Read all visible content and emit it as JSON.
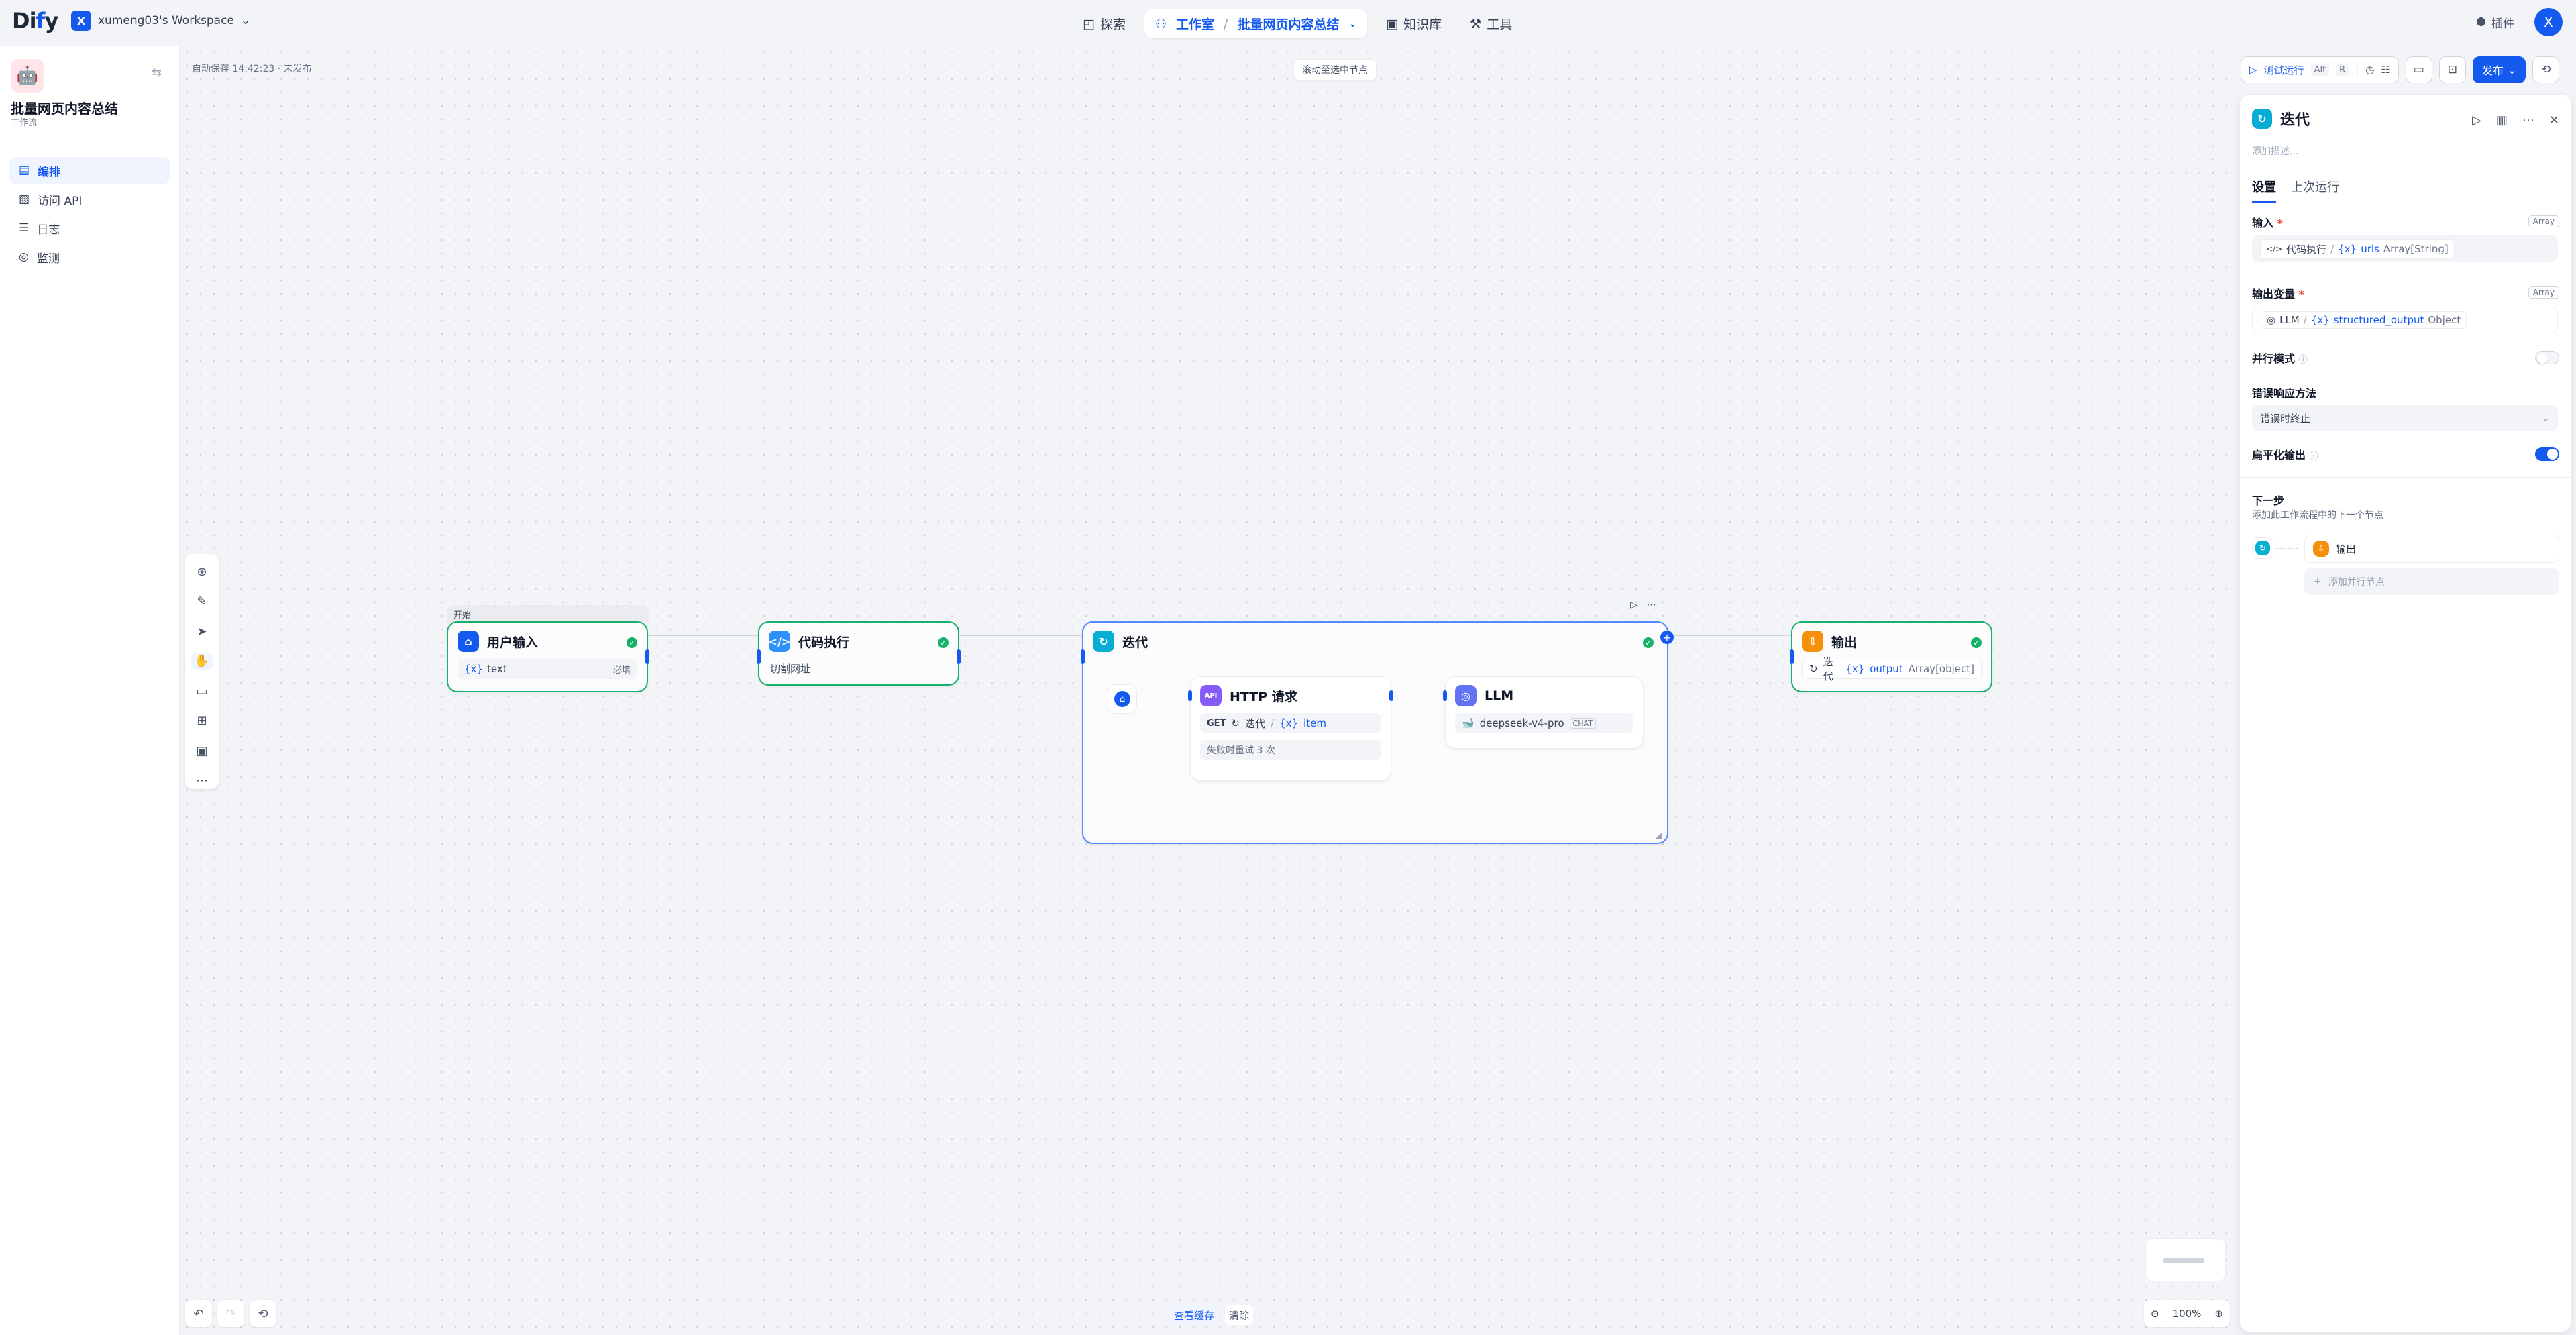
{
  "topbar": {
    "logo_pre": "Di",
    "logo_mid": "f",
    "logo_post": "y",
    "workspace_initial": "X",
    "workspace_name": "xumeng03's Workspace",
    "nav": {
      "explore": "探索",
      "studio": "工作室",
      "current_app": "批量网页内容总结",
      "knowledge": "知识库",
      "tools": "工具"
    },
    "plugins": "插件",
    "avatar_initial": "X"
  },
  "sidebar": {
    "app_title": "批量网页内容总结",
    "app_type": "工作流",
    "menu": [
      {
        "label": "编排",
        "icon": "orchestrate-icon"
      },
      {
        "label": "访问 API",
        "icon": "api-icon"
      },
      {
        "label": "日志",
        "icon": "logs-icon"
      },
      {
        "label": "监测",
        "icon": "monitor-icon"
      }
    ]
  },
  "canvas": {
    "autosave": "自动保存 14:42:23 · 未发布",
    "scroll_to_selected": "滚动至选中节点",
    "start_label": "开始",
    "nodes": {
      "user_input": {
        "title": "用户输入",
        "var": "text",
        "required": "必填"
      },
      "code": {
        "title": "代码执行",
        "desc": "切割网址"
      },
      "iteration": {
        "title": "迭代"
      },
      "http": {
        "title": "HTTP 请求",
        "method": "GET",
        "source": "迭代",
        "var": "item",
        "retry": "失败时重试 3 次"
      },
      "llm": {
        "title": "LLM",
        "model": "deepseek-v4-pro",
        "mode": "CHAT"
      },
      "output": {
        "title": "输出",
        "source": "迭代",
        "var": "output",
        "type": "Array[object]"
      }
    },
    "view_cache": "查看缓存",
    "clear": "清除",
    "zoom": "100%"
  },
  "toolbar_right": {
    "test_run": "测试运行",
    "shortcut_alt": "Alt",
    "shortcut_r": "R",
    "publish": "发布"
  },
  "panel": {
    "title": "迭代",
    "description_placeholder": "添加描述...",
    "tabs": [
      "设置",
      "上次运行"
    ],
    "input": {
      "label": "输入",
      "type": "Array",
      "node": "代码执行",
      "var": "urls",
      "var_type": "Array[String]"
    },
    "output_var": {
      "label": "输出变量",
      "type": "Array",
      "node": "LLM",
      "var": "structured_output",
      "var_type": "Object"
    },
    "parallel": {
      "label": "并行模式",
      "on": false
    },
    "error": {
      "label": "错误响应方法",
      "value": "错误时终止"
    },
    "flatten": {
      "label": "扁平化输出",
      "on": true
    },
    "next": {
      "title": "下一步",
      "desc": "添加此工作流程中的下一个节点",
      "node": "输出",
      "add_parallel": "添加并行节点"
    }
  },
  "colors": {
    "accent": "#155aef",
    "success": "#17b26a",
    "iteration": "#06aed4",
    "http": "#875bf7",
    "llm": "#6172f3",
    "output": "#f79009"
  }
}
